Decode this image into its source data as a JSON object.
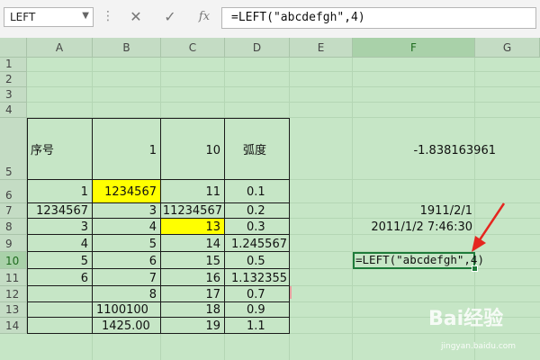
{
  "formula_bar": {
    "name_box": "LEFT",
    "cancel_symbol": "✕",
    "enter_symbol": "✓",
    "fx_label": "fx",
    "formula": "=LEFT(\"abcdefgh\",4)"
  },
  "columns": [
    "A",
    "B",
    "C",
    "D",
    "E",
    "F",
    "G"
  ],
  "rows": [
    "1",
    "2",
    "3",
    "4",
    "5",
    "6",
    "7",
    "8",
    "9",
    "10",
    "11",
    "12",
    "13",
    "14"
  ],
  "cells": {
    "A5": "序号",
    "B5": "1",
    "C5": "10",
    "D5": "弧度",
    "F5": "-1.838163961",
    "A6": "1",
    "B6": "1234567",
    "C6": "11",
    "D6": "0.1",
    "A7": "1234567",
    "B7": "3",
    "C7": "11234567",
    "D7": "0.2",
    "F7": "1911/2/1",
    "A8": "3",
    "B8": "4",
    "C8": "13",
    "D8": "0.3",
    "F8": "2011/1/2 7:46:30",
    "A9": "4",
    "B9": "5",
    "C9": "14",
    "D9": "1.245567",
    "A10": "5",
    "B10": "6",
    "C10": "15",
    "D10": "0.5",
    "F10": "=LEFT(\"abcdefgh\",4)",
    "A11": "6",
    "B11": "7",
    "C11": "16",
    "D11": "1.132355",
    "B12": "8",
    "C12": "17",
    "D12": "0.7",
    "B13": "1100100",
    "C13": "18",
    "D13": "0.9",
    "B14": "1425.00",
    "C14": "19",
    "D14": "1.1"
  },
  "highlight_color": "#ffff00",
  "accent_color": "#1e7b3a",
  "arrow_color": "#e5261f",
  "watermark": {
    "logo": "Bai经验",
    "url": "jingyan.baidu.com"
  }
}
